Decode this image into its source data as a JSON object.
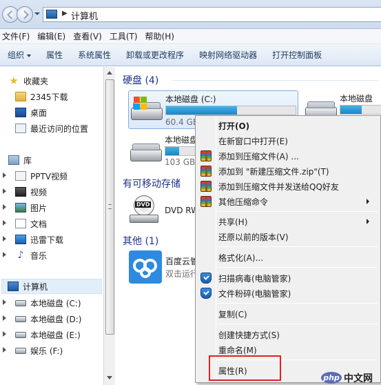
{
  "address_bar": {
    "path": "计算机"
  },
  "menubar": [
    "文件(F)",
    "编辑(E)",
    "查看(V)",
    "工具(T)",
    "帮助(H)"
  ],
  "toolbar": {
    "organize": "组织",
    "properties": "属性",
    "system_properties": "系统属性",
    "uninstall": "卸载或更改程序",
    "map_drive": "映射网络驱动器",
    "control_panel": "打开控制面板"
  },
  "nav": {
    "favorites": "收藏夹",
    "fav_items": [
      "2345下载",
      "桌面",
      "最近访问的位置"
    ],
    "libraries": "库",
    "lib_items": [
      "PPTV视频",
      "视频",
      "图片",
      "文档",
      "迅雷下载",
      "音乐"
    ],
    "computer": "计算机",
    "drives": [
      "本地磁盘 (C:)",
      "本地磁盘 (D:)",
      "本地磁盘 (E:)",
      "娱乐 (F:)"
    ]
  },
  "content": {
    "hard_disks_header": "硬盘 (4)",
    "removable_header": "有可移动存储",
    "other_header": "其他 (1)",
    "drive_c": {
      "name": "本地磁盘 (C:)",
      "free": "60.4 GB",
      "used_fraction": 0.55
    },
    "drive_2": {
      "name": "本地磁盘",
      "used_fraction": 0.4
    },
    "drive_3": {
      "name": "本地磁盘",
      "free": "103 GB"
    },
    "dvd": {
      "name": "DVD RW",
      "label": "DVD"
    },
    "baidu": {
      "name": "百度云管",
      "desc": "双击运行"
    }
  },
  "context_menu": {
    "open": "打开(O)",
    "open_new_window": "在新窗口中打开(E)",
    "add_archive": "添加到压缩文件(A) ...",
    "add_zip": "添加到 \"新建压缩文件.zip\"(T)",
    "add_send_qq": "添加到压缩文件并发送给QQ好友",
    "other_compress": "其他压缩命令",
    "share": "共享(H)",
    "restore": "还原以前的版本(V)",
    "format": "格式化(A)...",
    "scan_virus": "扫描病毒(电脑管家)",
    "shred": "文件粉碎(电脑管家)",
    "copy": "复制(C)",
    "create_shortcut": "创建快捷方式(S)",
    "rename": "重命名(M)",
    "properties": "属性(R)"
  },
  "watermark": {
    "logo": "php",
    "text": "中文网"
  }
}
